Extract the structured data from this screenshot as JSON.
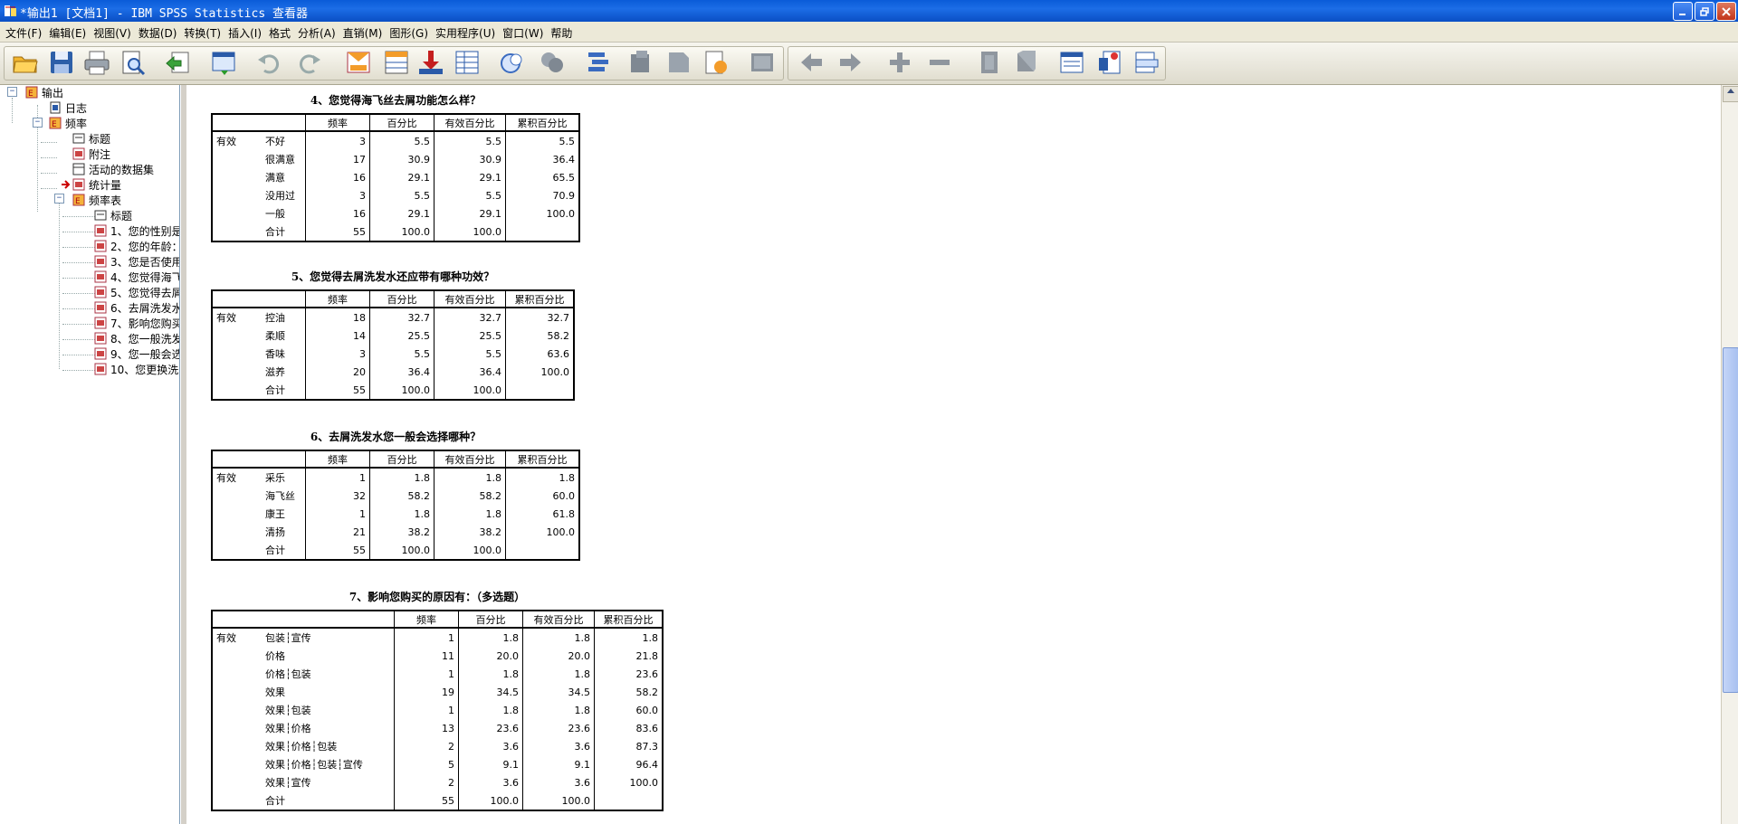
{
  "window": {
    "title": "*输出1 [文档1] - IBM SPSS Statistics 查看器",
    "buttons": [
      "minimize",
      "restore",
      "close"
    ]
  },
  "menu": [
    "文件(F)",
    "编辑(E)",
    "视图(V)",
    "数据(D)",
    "转换(T)",
    "插入(I)",
    "格式",
    "分析(A)",
    "直销(M)",
    "图形(G)",
    "实用程序(U)",
    "窗口(W)",
    "帮助"
  ],
  "toolbar": {
    "icons": [
      "open-icon",
      "save-icon",
      "print-icon",
      "print-preview-icon",
      "export-icon",
      "recall-dialog-icon",
      "undo-icon",
      "redo-icon",
      "goto-data-icon",
      "goto-case-icon",
      "goto-variable-icon",
      "variables-icon",
      "split-icon",
      "weight-icon",
      "select-cases-icon",
      "value-labels-icon",
      "designate-window-icon",
      "show-outline-icon",
      "hide-outline-icon",
      "promote-icon",
      "demote-icon",
      "expand-icon",
      "collapse-icon",
      "show-icon",
      "hide-icon",
      "insert-heading-icon",
      "insert-title-icon",
      "insert-text-icon"
    ]
  },
  "outline": {
    "nodes": [
      {
        "label": "输出",
        "icon": "output-icon"
      },
      {
        "label": "日志",
        "icon": "log-icon"
      },
      {
        "label": "频率",
        "icon": "frequencies-icon"
      },
      {
        "label": "标题",
        "icon": "title-icon"
      },
      {
        "label": "附注",
        "icon": "notes-icon"
      },
      {
        "label": "活动的数据集",
        "icon": "dataset-icon"
      },
      {
        "label": "统计量",
        "icon": "statistics-icon"
      },
      {
        "label": "频率表",
        "icon": "frequency-table-icon"
      },
      {
        "label": "标题",
        "icon": "title-icon"
      },
      {
        "label": "1、您的性别是",
        "icon": "table-icon"
      },
      {
        "label": "2、您的年龄：",
        "icon": "table-icon"
      },
      {
        "label": "3、您是否使用",
        "icon": "table-icon"
      },
      {
        "label": "4、您觉得海飞",
        "icon": "table-icon"
      },
      {
        "label": "5、您觉得去屑",
        "icon": "table-icon"
      },
      {
        "label": "6、去屑洗发水",
        "icon": "table-icon"
      },
      {
        "label": "7、影响您购买",
        "icon": "table-icon"
      },
      {
        "label": "8、您一般洗发",
        "icon": "table-icon"
      },
      {
        "label": "9、您一般会选",
        "icon": "table-icon"
      },
      {
        "label": "10、您更换洗",
        "icon": "table-icon"
      }
    ]
  },
  "headers": [
    "频率",
    "百分比",
    "有效百分比",
    "累积百分比"
  ],
  "valid_label": "有效",
  "tables": [
    {
      "title": "4、您觉得海飞丝去屑功能怎么样？",
      "rows": [
        {
          "cat": "不好",
          "freq": "3",
          "pct": "5.5",
          "valid": "5.5",
          "cum": "5.5"
        },
        {
          "cat": "很满意",
          "freq": "17",
          "pct": "30.9",
          "valid": "30.9",
          "cum": "36.4"
        },
        {
          "cat": "满意",
          "freq": "16",
          "pct": "29.1",
          "valid": "29.1",
          "cum": "65.5"
        },
        {
          "cat": "没用过",
          "freq": "3",
          "pct": "5.5",
          "valid": "5.5",
          "cum": "70.9"
        },
        {
          "cat": "一般",
          "freq": "16",
          "pct": "29.1",
          "valid": "29.1",
          "cum": "100.0"
        },
        {
          "cat": "合计",
          "freq": "55",
          "pct": "100.0",
          "valid": "100.0",
          "cum": ""
        }
      ]
    },
    {
      "title": "5、您觉得去屑洗发水还应带有哪种功效？",
      "rows": [
        {
          "cat": "控油",
          "freq": "18",
          "pct": "32.7",
          "valid": "32.7",
          "cum": "32.7"
        },
        {
          "cat": "柔顺",
          "freq": "14",
          "pct": "25.5",
          "valid": "25.5",
          "cum": "58.2"
        },
        {
          "cat": "香味",
          "freq": "3",
          "pct": "5.5",
          "valid": "5.5",
          "cum": "63.6"
        },
        {
          "cat": "滋养",
          "freq": "20",
          "pct": "36.4",
          "valid": "36.4",
          "cum": "100.0"
        },
        {
          "cat": "合计",
          "freq": "55",
          "pct": "100.0",
          "valid": "100.0",
          "cum": ""
        }
      ]
    },
    {
      "title": "6、去屑洗发水您一般会选择哪种？",
      "rows": [
        {
          "cat": "采乐",
          "freq": "1",
          "pct": "1.8",
          "valid": "1.8",
          "cum": "1.8"
        },
        {
          "cat": "海飞丝",
          "freq": "32",
          "pct": "58.2",
          "valid": "58.2",
          "cum": "60.0"
        },
        {
          "cat": "康王",
          "freq": "1",
          "pct": "1.8",
          "valid": "1.8",
          "cum": "61.8"
        },
        {
          "cat": "清扬",
          "freq": "21",
          "pct": "38.2",
          "valid": "38.2",
          "cum": "100.0"
        },
        {
          "cat": "合计",
          "freq": "55",
          "pct": "100.0",
          "valid": "100.0",
          "cum": ""
        }
      ]
    },
    {
      "title": "7、影响您购买的原因有：（多选题）",
      "rows": [
        {
          "cat": "包装┆宣传",
          "freq": "1",
          "pct": "1.8",
          "valid": "1.8",
          "cum": "1.8"
        },
        {
          "cat": "价格",
          "freq": "11",
          "pct": "20.0",
          "valid": "20.0",
          "cum": "21.8"
        },
        {
          "cat": "价格┆包装",
          "freq": "1",
          "pct": "1.8",
          "valid": "1.8",
          "cum": "23.6"
        },
        {
          "cat": "效果",
          "freq": "19",
          "pct": "34.5",
          "valid": "34.5",
          "cum": "58.2"
        },
        {
          "cat": "效果┆包装",
          "freq": "1",
          "pct": "1.8",
          "valid": "1.8",
          "cum": "60.0"
        },
        {
          "cat": "效果┆价格",
          "freq": "13",
          "pct": "23.6",
          "valid": "23.6",
          "cum": "83.6"
        },
        {
          "cat": "效果┆价格┆包装",
          "freq": "2",
          "pct": "3.6",
          "valid": "3.6",
          "cum": "87.3"
        },
        {
          "cat": "效果┆价格┆包装┆宣传",
          "freq": "5",
          "pct": "9.1",
          "valid": "9.1",
          "cum": "96.4"
        },
        {
          "cat": "效果┆宣传",
          "freq": "2",
          "pct": "3.6",
          "valid": "3.6",
          "cum": "100.0"
        },
        {
          "cat": "合计",
          "freq": "55",
          "pct": "100.0",
          "valid": "100.0",
          "cum": ""
        }
      ]
    }
  ]
}
